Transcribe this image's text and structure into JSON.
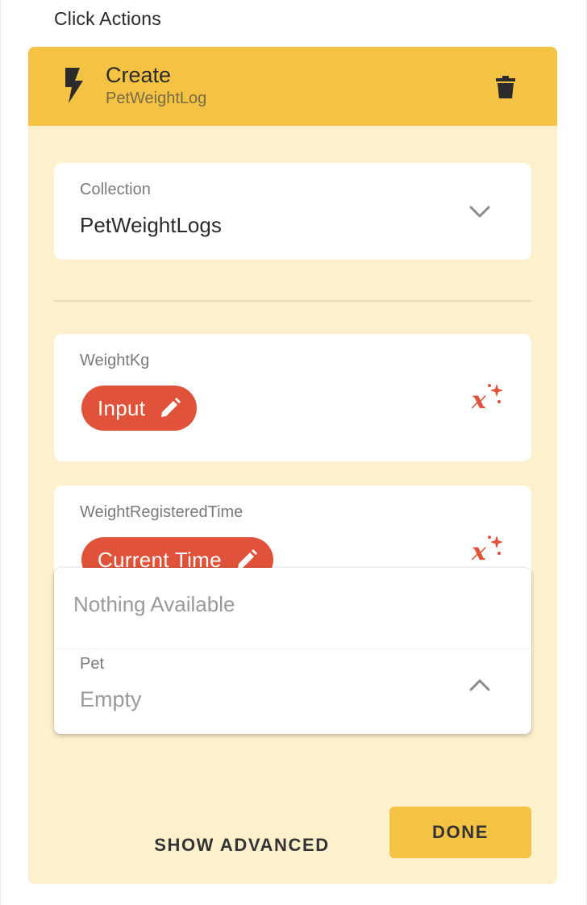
{
  "section": {
    "title": "Click Actions"
  },
  "action": {
    "title": "Create",
    "subtitle": "PetWeightLog",
    "icon": "lightning-bolt-icon",
    "delete_icon": "trash-icon"
  },
  "collection": {
    "label": "Collection",
    "value": "PetWeightLogs"
  },
  "fields": [
    {
      "label": "WeightKg",
      "chip": "Input"
    },
    {
      "label": "WeightRegisteredTime",
      "chip": "Current Time"
    }
  ],
  "dropdown": {
    "empty_text": "Nothing Available"
  },
  "pet": {
    "label": "Pet",
    "value": "Empty"
  },
  "buttons": {
    "show_advanced": "SHOW ADVANCED",
    "done": "DONE"
  },
  "colors": {
    "header": "#f5c344",
    "card_background": "#fdf0cc",
    "chip": "#e0533a",
    "formula_icon": "#e0533a"
  }
}
